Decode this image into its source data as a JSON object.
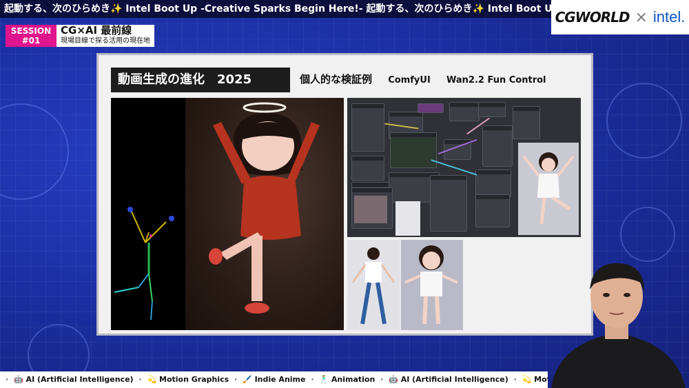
{
  "ticker_top": {
    "text": "起動する、次のひらめき✨ Intel Boot Up -Creative Sparks Begin Here!- 起動する、次のひらめき✨ Intel Boot Up -Cr"
  },
  "logos": {
    "cgworld": "CGWORLD",
    "cross": "×",
    "intel": "intel."
  },
  "session": {
    "badge_line1": "SESSION",
    "badge_line2": "#01",
    "title": "CG×AI 最前線",
    "subtitle": "現場目線で探る活用の現在地"
  },
  "slide": {
    "heading": "動画生成の進化　2025",
    "subheading": "個人的な検証例",
    "tool_1": "ComfyUI",
    "tool_2": "Wan2.2 Fun Control"
  },
  "ticker_bottom": {
    "items": [
      "🤖 AI (Artificial Intelligence)",
      "💫 Motion Graphics",
      "🖌️ Indie Anime",
      "🕺 Animation",
      "🤖 AI (Artificial Intelligence)",
      "💫 Motion Graphics"
    ]
  },
  "colors": {
    "accent_pink": "#e0148c",
    "background_blue": "#1a2c9c",
    "intel_blue": "#0a55c8"
  }
}
